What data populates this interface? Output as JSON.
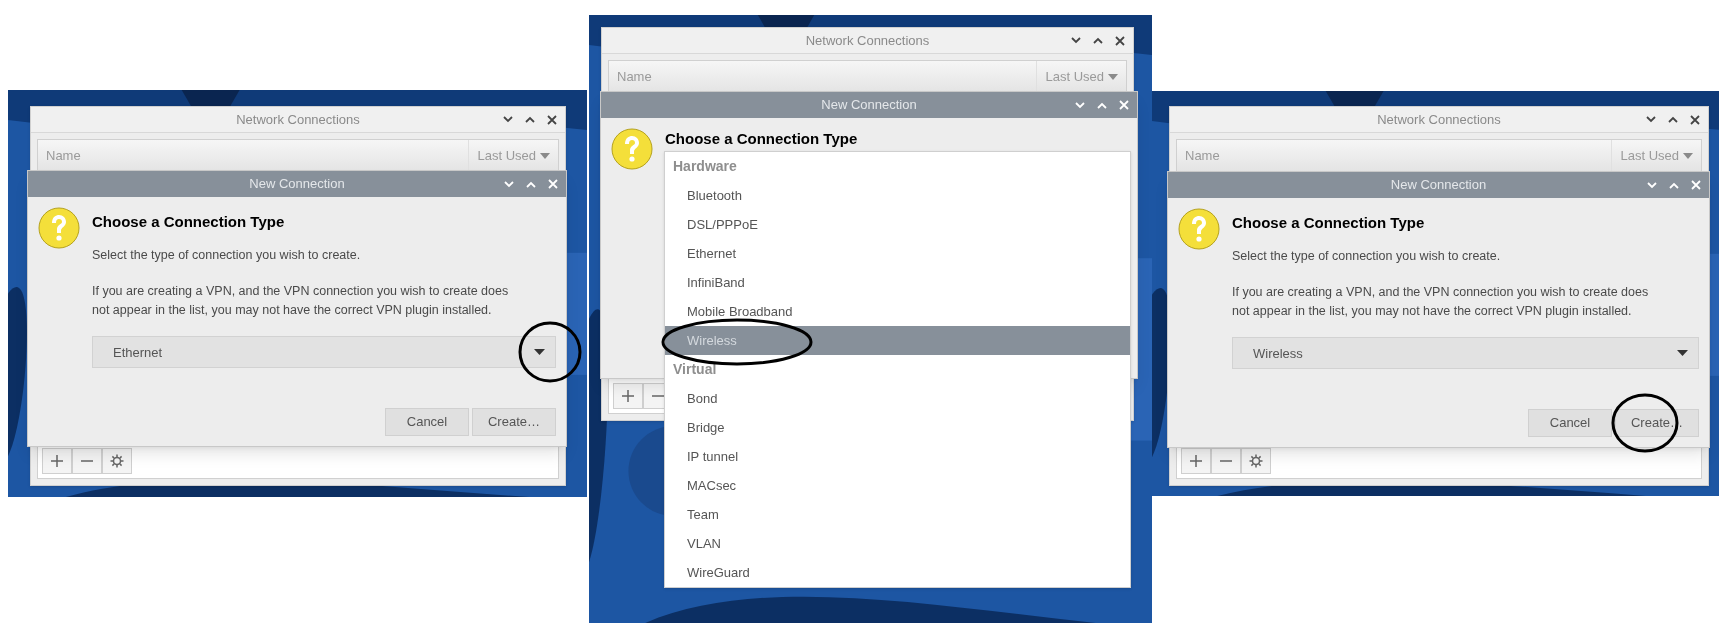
{
  "panels": [
    {
      "kind": "combo",
      "main_window": {
        "title": "Network Connections",
        "columns": [
          "Name",
          "Last Used"
        ]
      },
      "dialog": {
        "title": "New Connection",
        "heading": "Choose a Connection Type",
        "description": "Select the type of connection you wish to create.",
        "note_lines": [
          "If you are creating a VPN, and the VPN connection you wish to create does",
          "not appear in the list, you may not have the correct VPN plugin installed."
        ],
        "combo": {
          "value": "Ethernet",
          "arrow_circled": true
        },
        "buttons": [
          {
            "label": "Cancel",
            "circled": false
          },
          {
            "label": "Create…",
            "circled": false
          }
        ]
      }
    },
    {
      "kind": "list",
      "main_window": {
        "title": "Network Connections",
        "columns": [
          "Name",
          "Last Used"
        ]
      },
      "dialog": {
        "title": "New Connection",
        "heading": "Choose a Connection Type",
        "list": [
          {
            "header": "Hardware",
            "items": [
              {
                "label": "Bluetooth",
                "selected": false,
                "circled": false
              },
              {
                "label": "DSL/PPPoE",
                "selected": false,
                "circled": false
              },
              {
                "label": "Ethernet",
                "selected": false,
                "circled": false
              },
              {
                "label": "InfiniBand",
                "selected": false,
                "circled": false
              },
              {
                "label": "Mobile Broadband",
                "selected": false,
                "circled": false
              },
              {
                "label": "Wireless",
                "selected": true,
                "circled": true
              }
            ]
          },
          {
            "header": "Virtual",
            "items": [
              {
                "label": "Bond",
                "selected": false,
                "circled": false
              },
              {
                "label": "Bridge",
                "selected": false,
                "circled": false
              },
              {
                "label": "IP tunnel",
                "selected": false,
                "circled": false
              },
              {
                "label": "MACsec",
                "selected": false,
                "circled": false
              },
              {
                "label": "Team",
                "selected": false,
                "circled": false
              },
              {
                "label": "VLAN",
                "selected": false,
                "circled": false
              },
              {
                "label": "WireGuard",
                "selected": false,
                "circled": false
              }
            ]
          }
        ]
      }
    },
    {
      "kind": "combo",
      "main_window": {
        "title": "Network Connections",
        "columns": [
          "Name",
          "Last Used"
        ]
      },
      "dialog": {
        "title": "New Connection",
        "heading": "Choose a Connection Type",
        "description": "Select the type of connection you wish to create.",
        "note_lines": [
          "If you are creating a VPN, and the VPN connection you wish to create does",
          "not appear in the list, you may not have the correct VPN plugin installed."
        ],
        "combo": {
          "value": "Wireless",
          "arrow_circled": false
        },
        "buttons": [
          {
            "label": "Cancel",
            "circled": false
          },
          {
            "label": "Create…",
            "circled": true
          }
        ]
      }
    }
  ]
}
